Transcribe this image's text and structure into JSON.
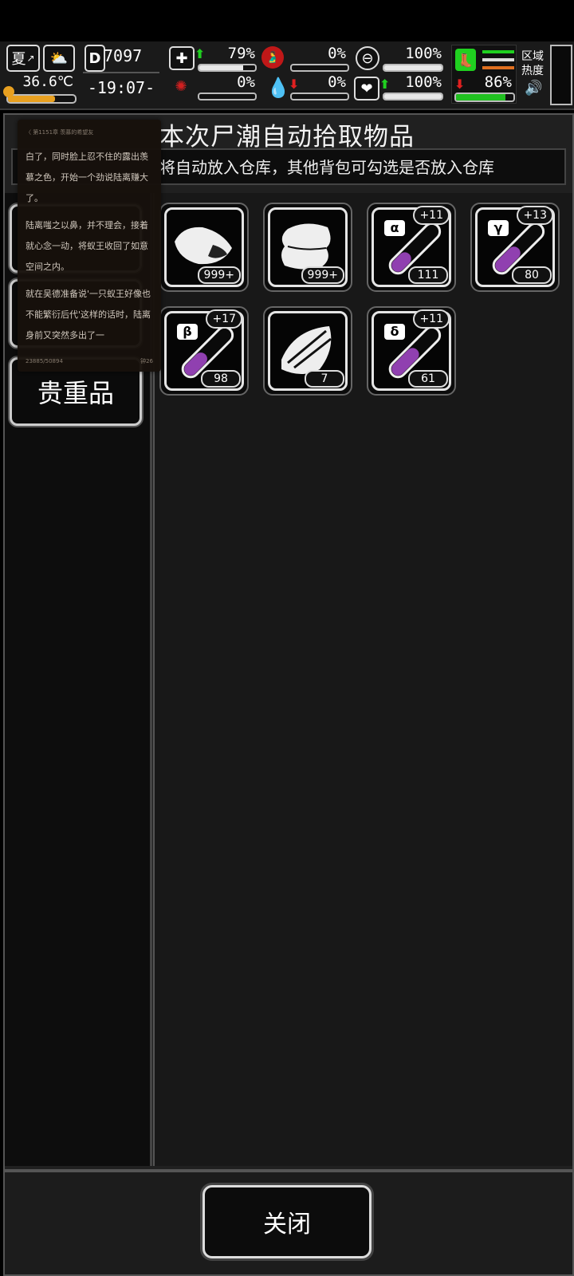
{
  "hud": {
    "season": "夏",
    "temperature": "36.6℃",
    "day_counter": "7097",
    "time": "-19:07-",
    "health_pct": "79%",
    "stomach_pct": "0%",
    "pill_pct": "100%",
    "infection_pct": "0%",
    "blood_pct": "0%",
    "heart_pct": "100%",
    "stamina_pct": "86%",
    "zone_label_1": "区域",
    "zone_label_2": "热度",
    "accent_green": "#20d020",
    "accent_red": "#e02020",
    "accent_orange": "#e07020"
  },
  "dialog": {
    "title": "本次尸潮自动拾取物品",
    "subtitle": "将自动放入仓库，其他背包可勾选是否放入仓库",
    "close_label": "关闭"
  },
  "tabs": [
    {
      "label": "贵重品"
    }
  ],
  "items": [
    {
      "name": "meat",
      "count": "999+",
      "bonus": "",
      "greek": ""
    },
    {
      "name": "cloth",
      "count": "999+",
      "bonus": "",
      "greek": ""
    },
    {
      "name": "alpha-potion",
      "count": "111",
      "bonus": "+11",
      "greek": "α"
    },
    {
      "name": "gamma-potion",
      "count": "80",
      "bonus": "+13",
      "greek": "γ"
    },
    {
      "name": "beta-potion",
      "count": "98",
      "bonus": "+17",
      "greek": "β"
    },
    {
      "name": "planks",
      "count": "7",
      "bonus": "",
      "greek": ""
    },
    {
      "name": "delta-potion",
      "count": "61",
      "bonus": "+11",
      "greek": "δ"
    }
  ],
  "overlay": {
    "header": "〈 第1151章 羡慕的希望友",
    "para1": "白了，同时脸上忍不住的露出羡慕之色，开始一个劲说陆离赚大了。",
    "para2": "陆离嗤之以鼻，并不理会，接着就心念一动，将蚁王收回了如意空间之内。",
    "para3": "就在吴德准备说'一只蚁王好像也不能繁衍后代'这样的话时，陆离身前又突然多出了一",
    "foot_left": "23885/50894",
    "foot_right": "钟26"
  }
}
